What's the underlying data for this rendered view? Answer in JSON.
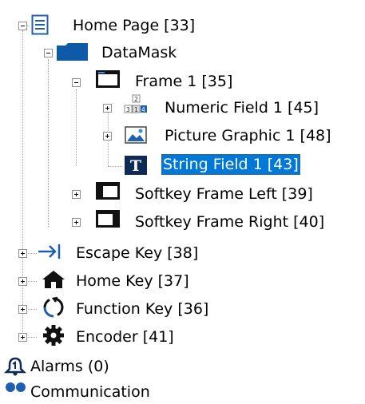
{
  "tree": {
    "home_page": "Home Page [33]",
    "datamask": "DataMask",
    "frame1": "Frame 1 [35]",
    "numeric_field": "Numeric Field 1 [45]",
    "picture_graphic": "Picture Graphic 1 [48]",
    "string_field": "String Field 1 [43]",
    "softkey_left": "Softkey Frame Left [39]",
    "softkey_right": "Softkey Frame Right [40]",
    "escape_key": "Escape Key [38]",
    "home_key": "Home Key [37]",
    "function_key": "Function Key [36]",
    "encoder": "Encoder [41]",
    "alarms": "Alarms (0)",
    "communication": "Communication"
  },
  "icons": {
    "home_page": "page-icon",
    "datamask": "folder-icon",
    "frame": "frame-icon",
    "numeric": "numeric-field-icon",
    "picture": "picture-icon",
    "string": "text-t-icon",
    "softkey_left": "softkey-frame-left-icon",
    "softkey_right": "softkey-frame-right-icon",
    "escape": "arrow-right-icon",
    "home": "house-icon",
    "function": "refresh-icon",
    "encoder": "gear-icon",
    "alarms": "bell-icon",
    "communication": "communication-icon"
  },
  "colors": {
    "selection": "#0078d7",
    "accent_blue": "#1f5fb0",
    "dark_icon": "#111111"
  }
}
